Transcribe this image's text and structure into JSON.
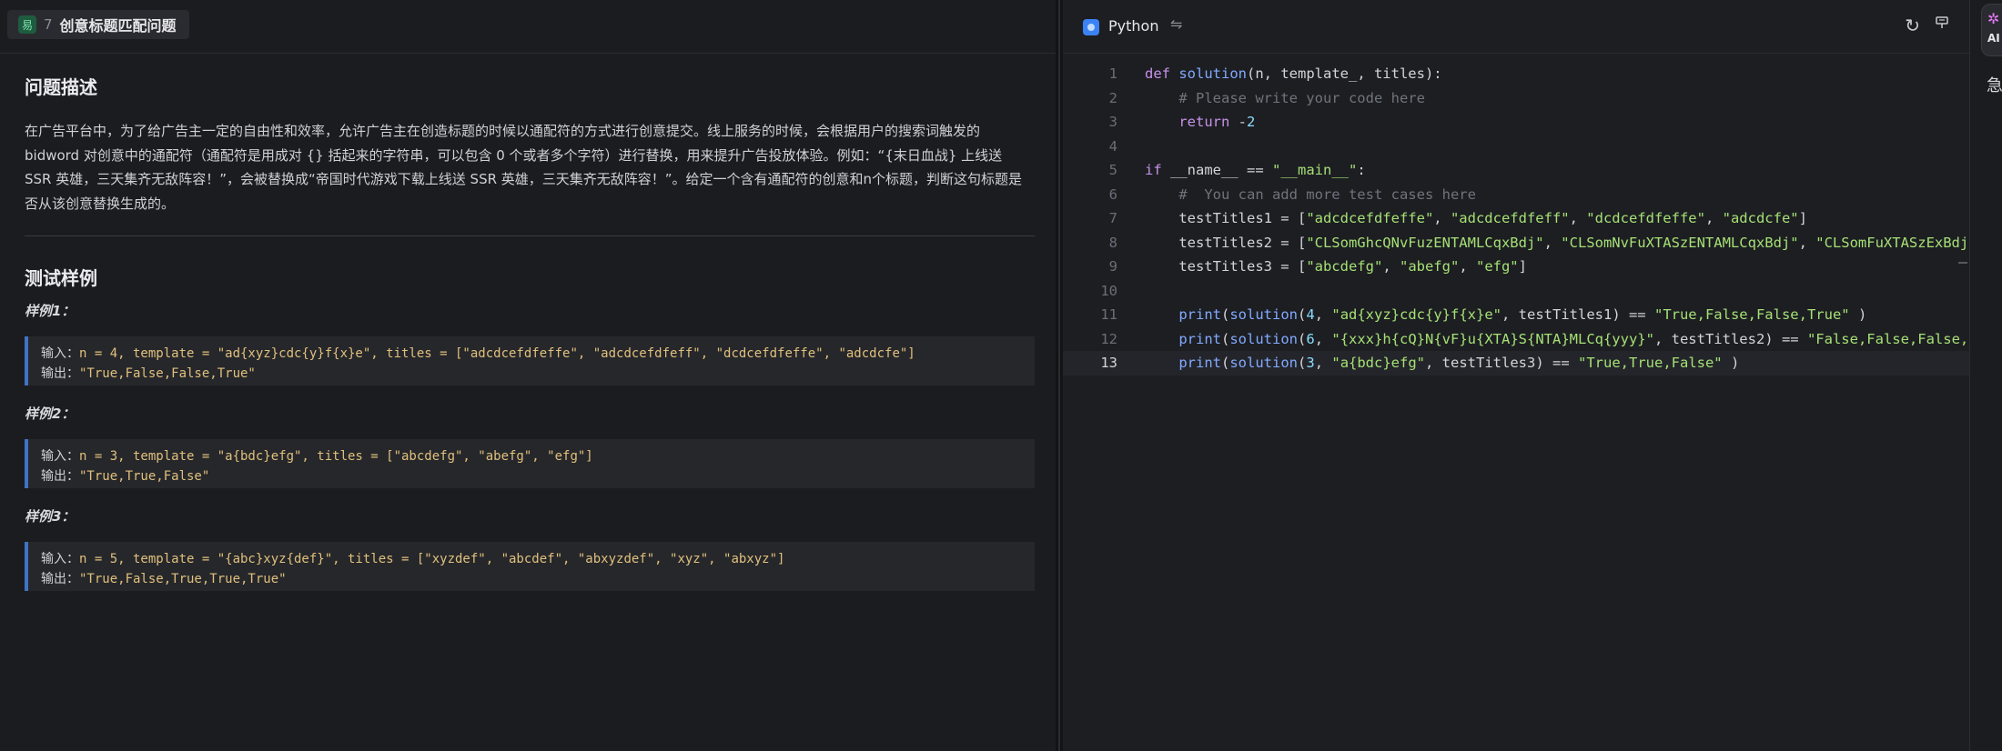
{
  "problem": {
    "difficulty": "易",
    "number": "7",
    "title": "创意标题匹配问题"
  },
  "sections": {
    "description_title": "问题描述",
    "description": "在广告平台中，为了给广告主一定的自由性和效率，允许广告主在创造标题的时候以通配符的方式进行创意提交。线上服务的时候，会根据用户的搜索词触发的 bidword 对创意中的通配符（通配符是用成对 {} 括起来的字符串，可以包含 0 个或者多个字符）进行替换，用来提升广告投放体验。例如：“{末日血战} 上线送 SSR 英雄，三天集齐无敌阵容！”，会被替换成“帝国时代游戏下载上线送 SSR 英雄，三天集齐无敌阵容！”。给定一个含有通配符的创意和n个标题，判断这句标题是否从该创意替换生成的。",
    "examples_title": "测试样例"
  },
  "examples": [
    {
      "label": "样例1：",
      "input_key": "输入：",
      "input": "n = 4, template = \"ad{xyz}cdc{y}f{x}e\", titles = [\"adcdcefdfeffe\", \"adcdcefdfeff\", \"dcdcefdfeffe\", \"adcdcfe\"]",
      "output_key": "输出：",
      "output": "\"True,False,False,True\""
    },
    {
      "label": "样例2：",
      "input_key": "输入：",
      "input": "n = 3, template = \"a{bdc}efg\", titles = [\"abcdefg\", \"abefg\", \"efg\"]",
      "output_key": "输出：",
      "output": "\"True,True,False\""
    },
    {
      "label": "样例3：",
      "input_key": "输入：",
      "input": "n = 5, template = \"{abc}xyz{def}\", titles = [\"xyzdef\", \"abcdef\", \"abxyzdef\", \"xyz\", \"abxyz\"]",
      "output_key": "输出：",
      "output": "\"True,False,True,True,True\""
    }
  ],
  "editor": {
    "language": "Python",
    "swap_icon": "swap-icon",
    "refresh_icon": "refresh-icon",
    "format_icon": "format-icon",
    "line_numbers": [
      "1",
      "2",
      "3",
      "4",
      "5",
      "6",
      "7",
      "8",
      "9",
      "10",
      "11",
      "12",
      "13"
    ],
    "lines": [
      "def solution(n, template_, titles):",
      "    # Please write your code here",
      "    return -2",
      "",
      "if __name__ == \"__main__\":",
      "    #  You can add more test cases here",
      "    testTitles1 = [\"adcdcefdfeffe\", \"adcdcefdfeff\", \"dcdcefdfeffe\", \"adcdcfe\"]",
      "    testTitles2 = [\"CLSomGhcQNvFuzENTAMLCqxBdj\", \"CLSomNvFuXTASzENTAMLCqxBdj\", \"CLSomFuXTASzExBdj",
      "    testTitles3 = [\"abcdefg\", \"abefg\", \"efg\"]",
      "",
      "    print(solution(4, \"ad{xyz}cdc{y}f{x}e\", testTitles1) == \"True,False,False,True\" )",
      "    print(solution(6, \"{xxx}h{cQ}N{vF}u{XTA}S{NTA}MLCq{yyy}\", testTitles2) == \"False,False,False,",
      "    print(solution(3, \"a{bdc}efg\", testTitles3) == \"True,True,False\" )"
    ],
    "active_line": "13"
  },
  "rail": {
    "ai_label": "AI",
    "glyph": "急"
  }
}
